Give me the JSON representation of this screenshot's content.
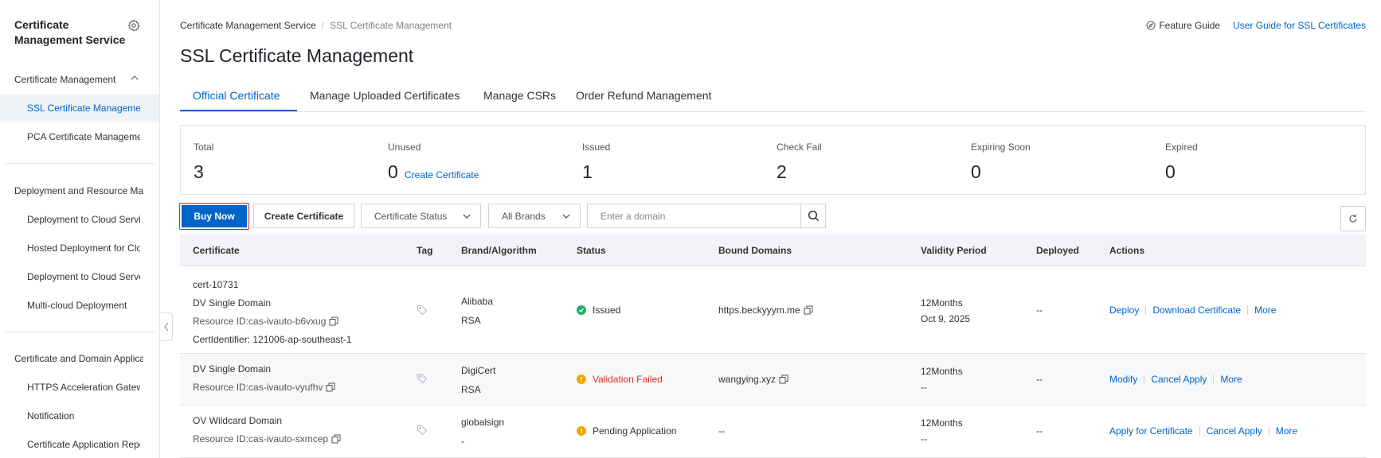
{
  "sidebar": {
    "title": "Certificate Management Service",
    "groups": [
      {
        "label": "Certificate Management"
      },
      {
        "label": "Deployment and Resource Management"
      },
      {
        "label": "Certificate and Domain Application"
      }
    ],
    "items": [
      {
        "label": "SSL Certificate Management"
      },
      {
        "label": "PCA Certificate Management"
      },
      {
        "label": "Deployment to Cloud Services"
      },
      {
        "label": "Hosted Deployment for Cloud"
      },
      {
        "label": "Deployment to Cloud Servers"
      },
      {
        "label": "Multi-cloud Deployment"
      },
      {
        "label": "HTTPS Acceleration Gateway"
      },
      {
        "label": "Notification"
      },
      {
        "label": "Certificate Application Repository"
      }
    ]
  },
  "breadcrumb": {
    "root": "Certificate Management Service",
    "separator": "/",
    "current": "SSL Certificate Management"
  },
  "header": {
    "feature_guide": "Feature Guide",
    "user_guide": "User Guide for SSL Certificates",
    "title": "SSL Certificate Management"
  },
  "tabs": [
    {
      "label": "Official Certificate"
    },
    {
      "label": "Manage Uploaded Certificates"
    },
    {
      "label": "Manage CSRs"
    },
    {
      "label": "Order Refund Management"
    }
  ],
  "stats": [
    {
      "label": "Total",
      "value": "3"
    },
    {
      "label": "Unused",
      "value": "0",
      "link": "Create Certificate"
    },
    {
      "label": "Issued",
      "value": "1"
    },
    {
      "label": "Check Fail",
      "value": "2"
    },
    {
      "label": "Expiring Soon",
      "value": "0"
    },
    {
      "label": "Expired",
      "value": "0"
    }
  ],
  "toolbar": {
    "buy_now": "Buy Now",
    "create_certificate": "Create Certificate",
    "status_select": "Certificate Status",
    "brand_select": "All Brands",
    "search_placeholder": "Enter a domain"
  },
  "table": {
    "columns": [
      "Certificate",
      "Tag",
      "Brand/Algorithm",
      "Status",
      "Bound Domains",
      "Validity Period",
      "Deployed",
      "Actions"
    ],
    "rows": [
      {
        "name": "cert-10731",
        "type": "DV Single Domain",
        "resource_id": "Resource ID:cas-ivauto-b6vxug",
        "identifier": "CertIdentifier: 121006-ap-southeast-1",
        "brand": "Alibaba",
        "algorithm": "RSA",
        "status": "Issued",
        "domain": "https.beckyyym.me",
        "validity": "12Months",
        "validity_date": "Oct 9, 2025",
        "deployed": "--",
        "actions": [
          "Deploy",
          "Download Certificate",
          "More"
        ]
      },
      {
        "type": "DV Single Domain",
        "resource_id": "Resource ID:cas-ivauto-vyufhv",
        "brand": "DigiCert",
        "algorithm": "RSA",
        "status": "Validation Failed",
        "domain": "wangying.xyz",
        "validity": "12Months",
        "validity_date": "--",
        "deployed": "--",
        "actions": [
          "Modify",
          "Cancel Apply",
          "More"
        ]
      },
      {
        "type": "OV Wildcard Domain",
        "resource_id": "Resource ID:cas-ivauto-sxmcep",
        "brand": "globalsign",
        "algorithm": "-",
        "status": "Pending Application",
        "domain": "--",
        "validity": "12Months",
        "validity_date": "--",
        "deployed": "--",
        "actions": [
          "Apply for Certificate",
          "Cancel Apply",
          "More"
        ]
      }
    ]
  },
  "colors": {
    "accent": "#0064c8",
    "success": "#23b066",
    "warning": "#f0a700",
    "error": "#d93026"
  }
}
